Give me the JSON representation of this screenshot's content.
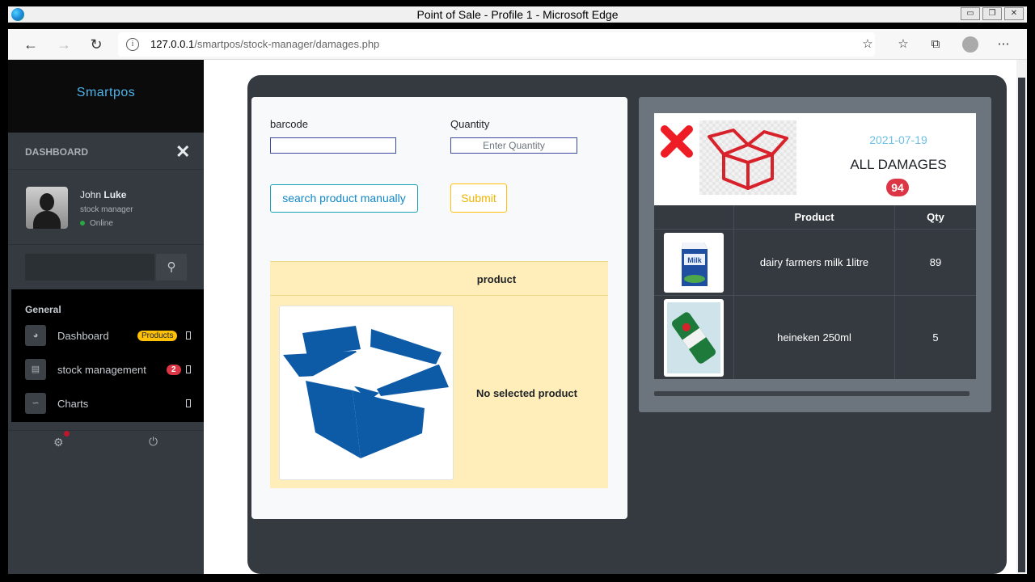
{
  "window": {
    "title": "Point of Sale - Profile 1 - Microsoft Edge",
    "url_host": "127.0.0.1",
    "url_path": "/smartpos/stock-manager/damages.php"
  },
  "sidebar": {
    "brand": "Smartpos",
    "dashboard_title": "DASHBOARD",
    "user": {
      "first_name": "John",
      "last_name": "Luke",
      "role": "stock manager",
      "status": "Online"
    },
    "menu_heading": "General",
    "items": [
      {
        "label": "Dashboard",
        "badge": "Products"
      },
      {
        "label": "stock management",
        "badge": "2"
      },
      {
        "label": "Charts",
        "badge": ""
      }
    ]
  },
  "form": {
    "barcode_label": "barcode",
    "barcode_value": "",
    "quantity_label": "Quantity",
    "quantity_placeholder": "Enter Quantity",
    "search_button": "search product manually",
    "submit_button": "Submit",
    "product_header": "product",
    "no_product_text": "No selected product"
  },
  "damages": {
    "date": "2021-07-19",
    "title": "ALL DAMAGES",
    "count": "94",
    "columns": [
      "",
      "Product",
      "Qty"
    ],
    "rows": [
      {
        "product": "dairy farmers milk 1litre",
        "qty": "89",
        "image": "milk-carton"
      },
      {
        "product": "heineken 250ml",
        "qty": "5",
        "image": "heineken-can"
      }
    ]
  },
  "colors": {
    "accent_blue": "#1187c7",
    "danger": "#dc3545",
    "warning": "#ffc107",
    "box_blue": "#0d5aa7",
    "box_red": "#d8222b"
  }
}
